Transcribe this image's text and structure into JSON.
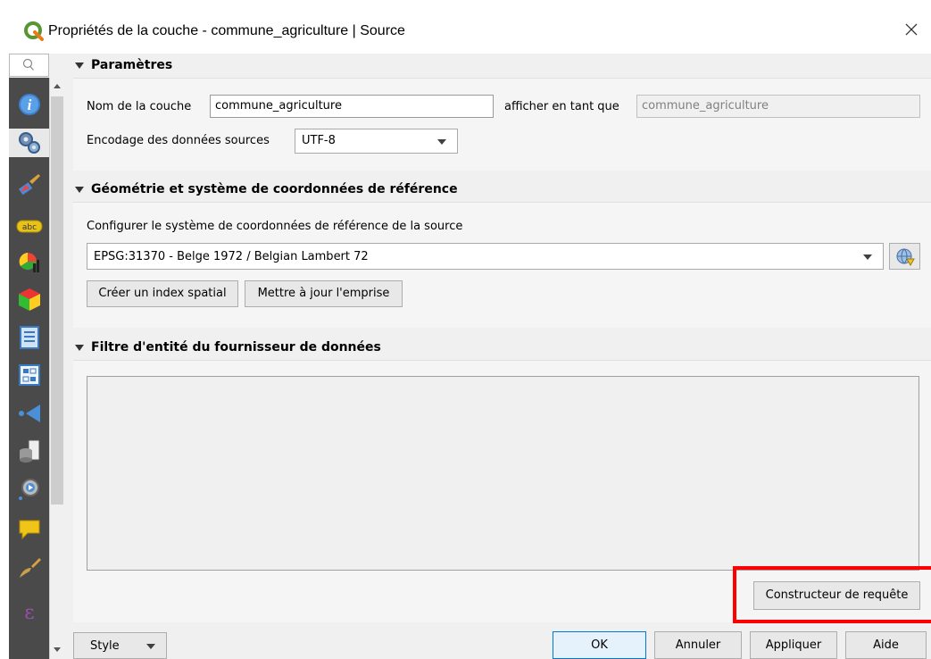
{
  "window": {
    "title": "Propriétés de la couche - commune_agriculture | Source",
    "close": "×"
  },
  "sections": {
    "parametres": {
      "header": "Paramètres",
      "layer_name_label": "Nom de la couche",
      "layer_name_value": "commune_agriculture",
      "display_as_label": "afficher en tant que",
      "display_as_value": "commune_agriculture",
      "encoding_label": "Encodage des données sources",
      "encoding_value": "UTF-8"
    },
    "geometrie": {
      "header": "Géométrie et système de coordonnées de référence",
      "crs_label": "Configurer le système de coordonnées de référence de la source",
      "crs_value": "EPSG:31370 - Belge 1972 / Belgian Lambert 72",
      "create_index_button": "Créer un index spatial",
      "update_extent_button": "Mettre à jour l'emprise"
    },
    "filtre": {
      "header": "Filtre d'entité du fournisseur de données",
      "query_builder_button": "Constructeur de requête"
    }
  },
  "footer": {
    "style_label": "Style",
    "ok_label": "OK",
    "cancel_label": "Annuler",
    "apply_label": "Appliquer",
    "help_label": "Aide"
  },
  "sidebar": {
    "search_icon": "search-icon",
    "icons": [
      "information-icon",
      "source-icon",
      "symbology-icon",
      "labels-icon",
      "diagrams-icon",
      "3d-view-icon",
      "fields-icon",
      "attributes-form-icon",
      "joins-icon",
      "auxiliary-storage-icon",
      "actions-icon",
      "display-icon",
      "rendering-icon",
      "variables-icon"
    ]
  },
  "colors": {
    "sidebar_bg": "#4a4a4a",
    "highlight": "#ff0000",
    "primary_border": "#0078d7"
  }
}
